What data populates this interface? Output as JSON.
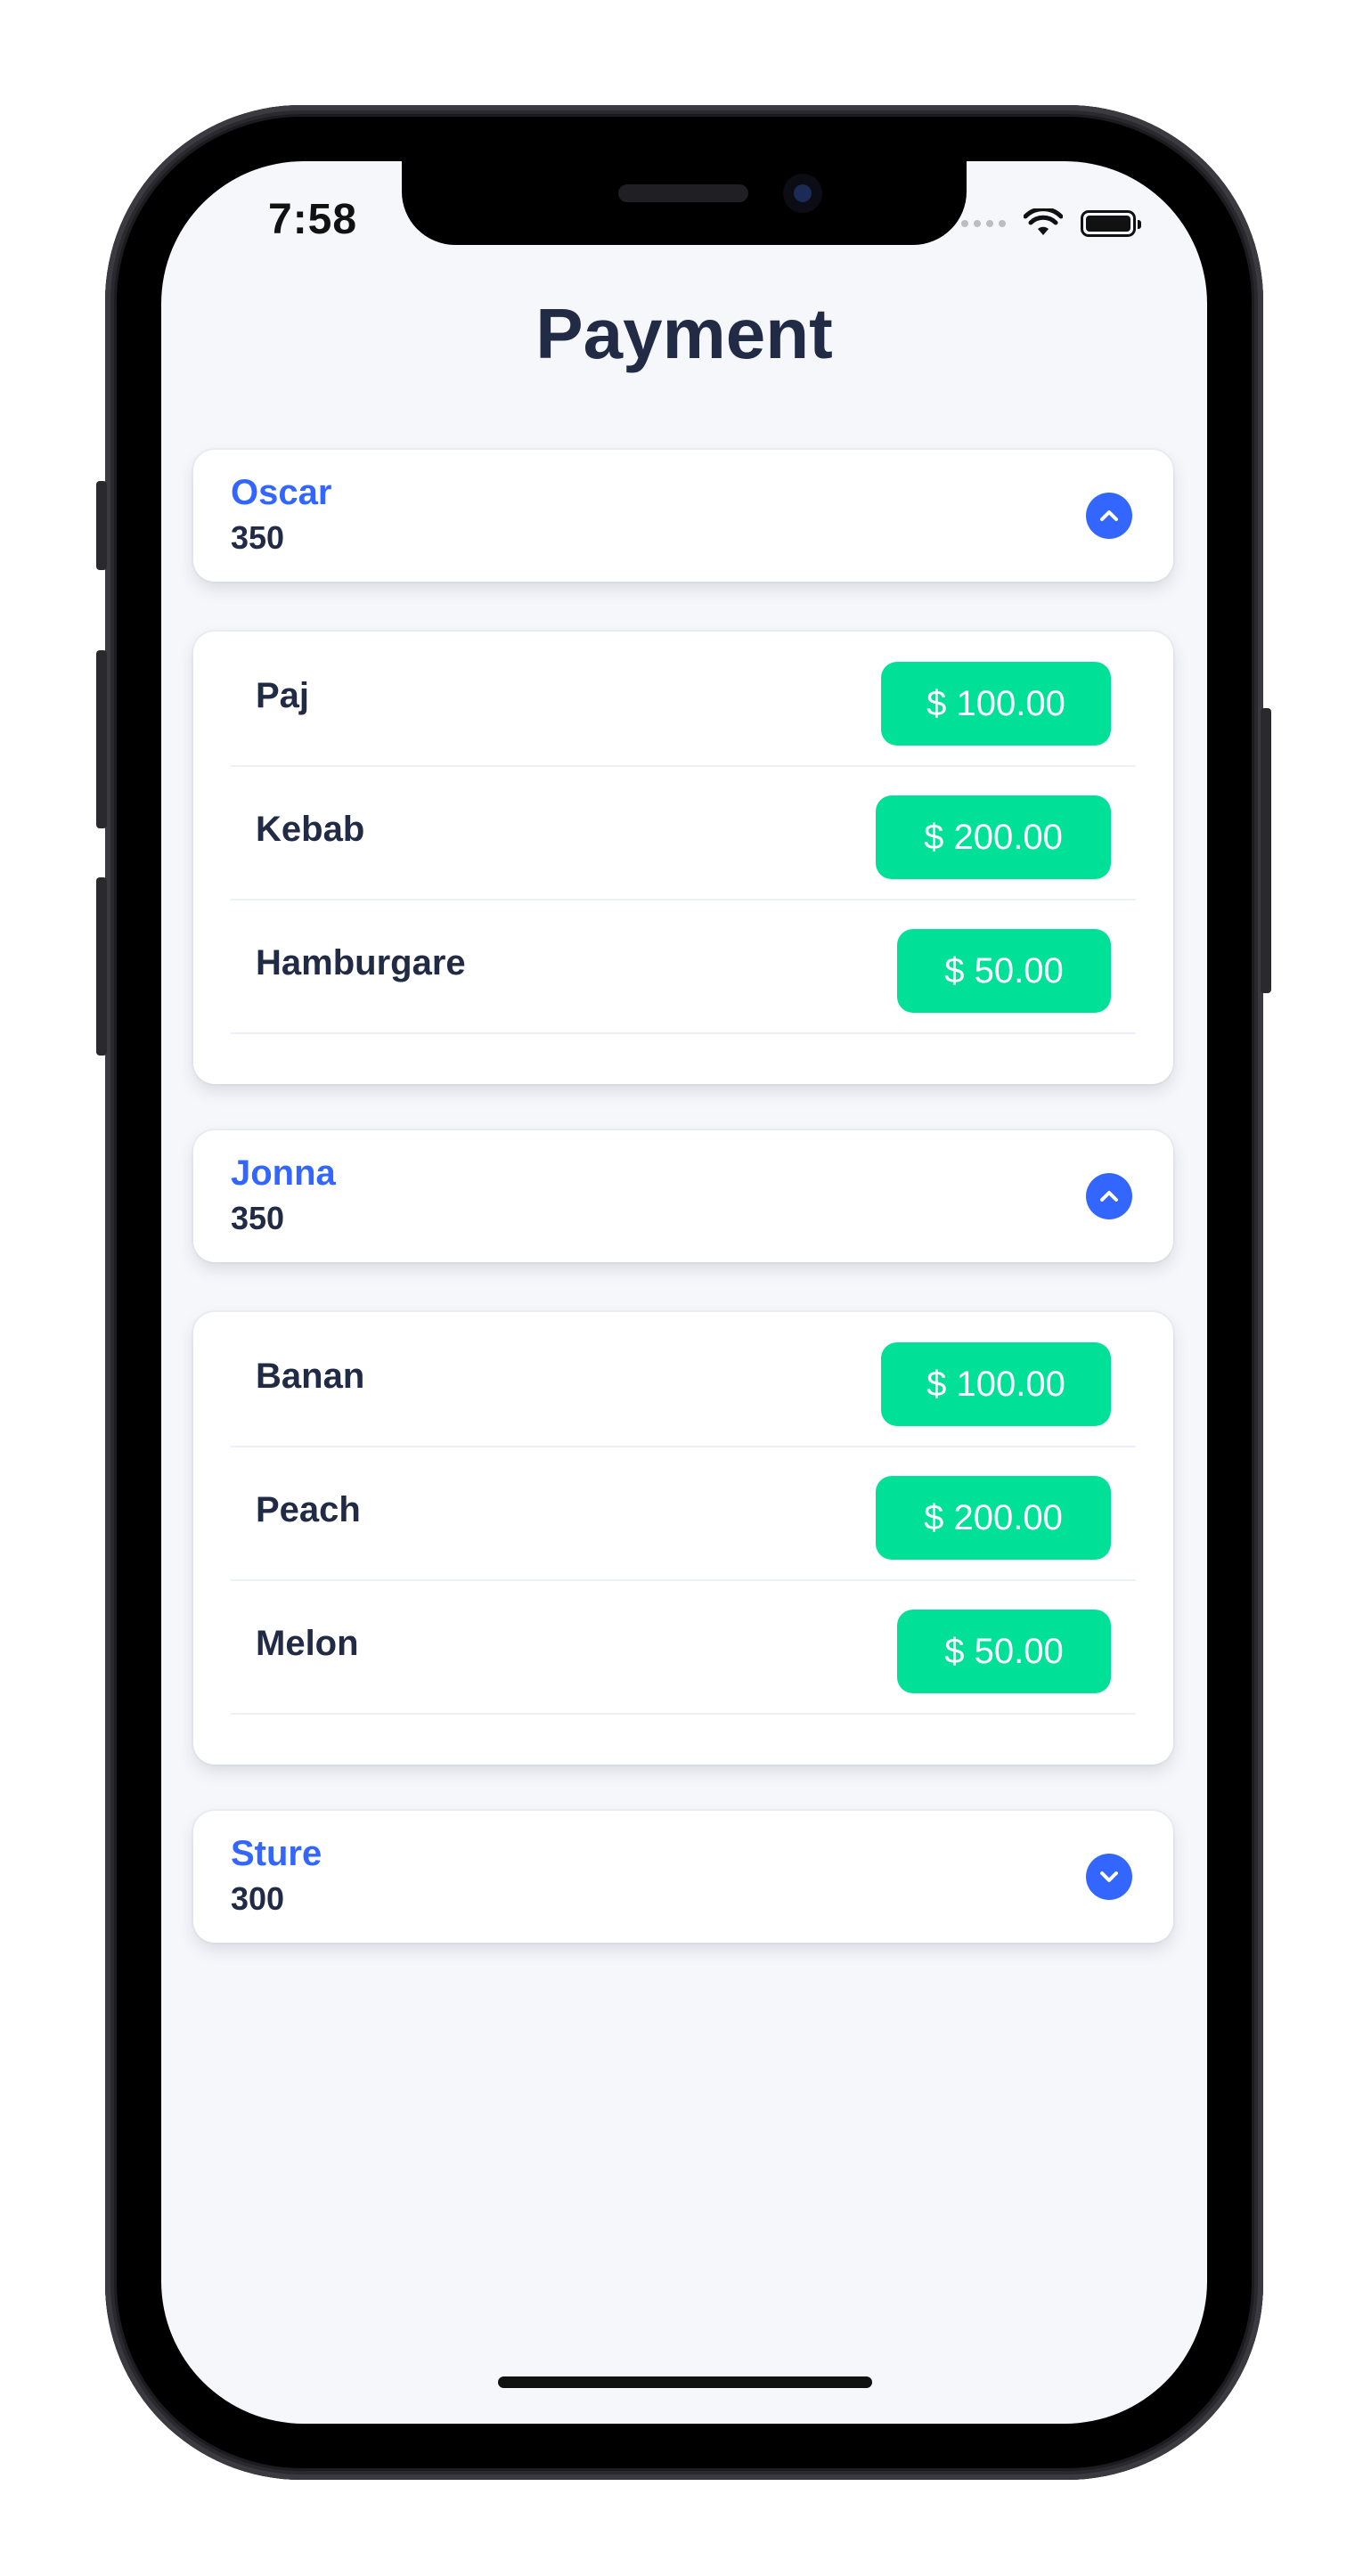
{
  "status_bar": {
    "time": "7:58"
  },
  "page_title": "Payment",
  "people": [
    {
      "name": "Oscar",
      "total": "350",
      "expanded": true,
      "items": [
        {
          "name": "Paj",
          "price": "$ 100.00"
        },
        {
          "name": "Kebab",
          "price": "$ 200.00"
        },
        {
          "name": "Hamburgare",
          "price": "$ 50.00"
        }
      ]
    },
    {
      "name": "Jonna",
      "total": "350",
      "expanded": true,
      "items": [
        {
          "name": "Banan",
          "price": "$ 100.00"
        },
        {
          "name": "Peach",
          "price": "$ 200.00"
        },
        {
          "name": "Melon",
          "price": "$ 50.00"
        }
      ]
    },
    {
      "name": "Sture",
      "total": "300",
      "expanded": false,
      "items": []
    }
  ],
  "colors": {
    "accent": "#3366ff",
    "price_bg": "#00e096",
    "text": "#222b45",
    "screen_bg": "#f6f7fb"
  },
  "icons": {
    "expanded": "chevron-up-icon",
    "collapsed": "chevron-down-icon"
  }
}
